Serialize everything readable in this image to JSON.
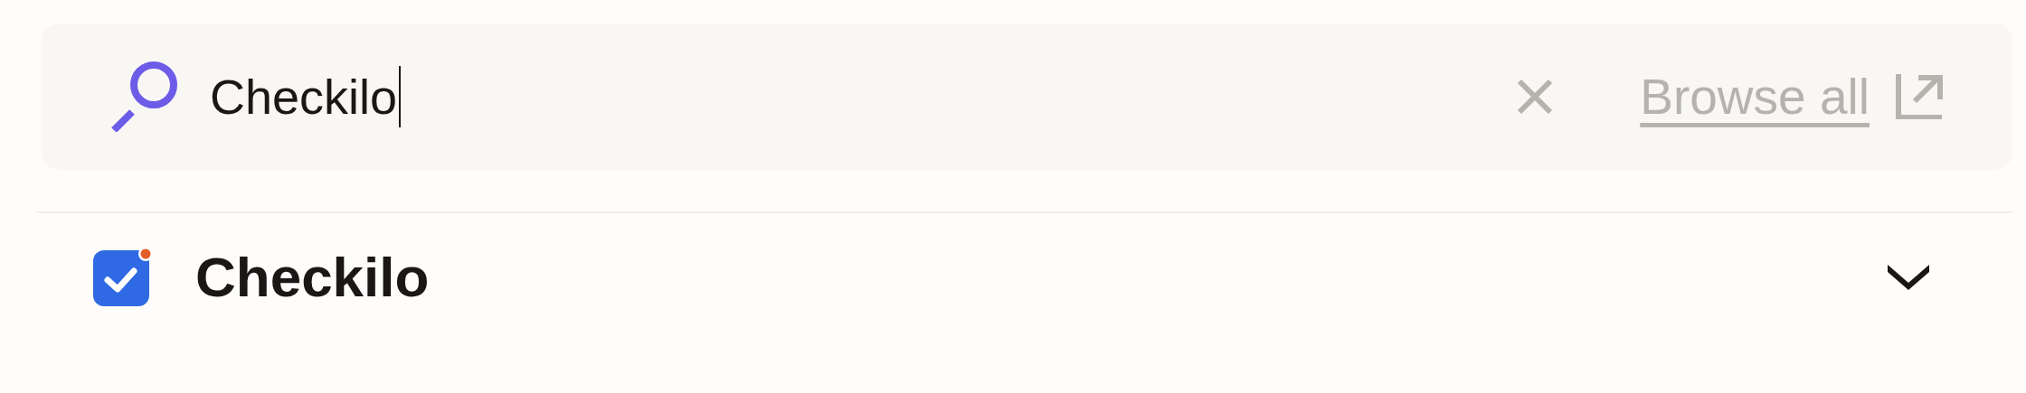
{
  "search": {
    "value": "Checkilo",
    "focused": true,
    "browse_link": "Browse all"
  },
  "results": [
    {
      "name": "Checkilo",
      "expanded": false
    }
  ]
}
